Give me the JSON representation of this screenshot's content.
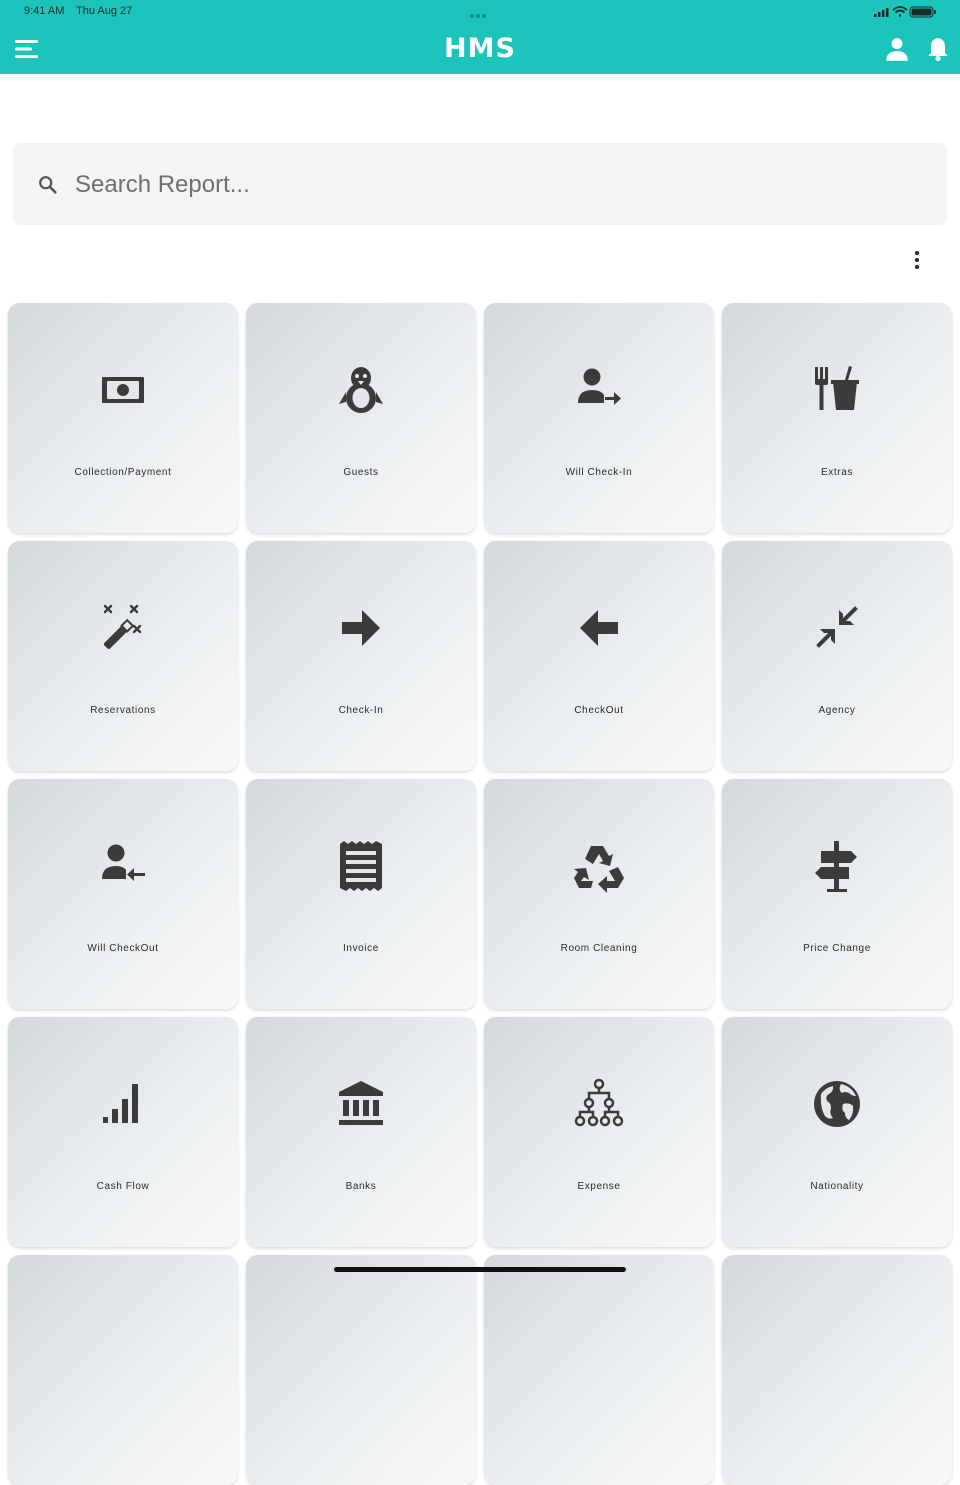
{
  "status_bar": {
    "time": "9:41 AM",
    "date": "Thu Aug 27"
  },
  "header": {
    "title": "HMS",
    "menu_icon": "hamburger-menu-icon",
    "user_icon": "user-icon",
    "notification_icon": "bell-icon",
    "color": "#1cc4bb"
  },
  "search": {
    "placeholder": "Search Report...",
    "value": ""
  },
  "reports": [
    {
      "label": "Collection/Payment",
      "icon": "money-icon"
    },
    {
      "label": "Guests",
      "icon": "penguin-icon"
    },
    {
      "label": "Will Check-In",
      "icon": "person-arrow-right-icon"
    },
    {
      "label": "Extras",
      "icon": "fastfood-icon"
    },
    {
      "label": "Reservations",
      "icon": "magic-wand-icon"
    },
    {
      "label": "Check-In",
      "icon": "arrow-right-icon"
    },
    {
      "label": "CheckOut",
      "icon": "arrow-left-icon"
    },
    {
      "label": "Agency",
      "icon": "collapse-arrows-icon"
    },
    {
      "label": "Will CheckOut",
      "icon": "person-arrow-left-icon"
    },
    {
      "label": "Invoice",
      "icon": "receipt-icon"
    },
    {
      "label": "Room Cleaning",
      "icon": "recycle-icon"
    },
    {
      "label": "Price Change",
      "icon": "signpost-icon"
    },
    {
      "label": "Cash Flow",
      "icon": "signal-bars-icon"
    },
    {
      "label": "Banks",
      "icon": "bank-icon"
    },
    {
      "label": "Expense",
      "icon": "hierarchy-icon"
    },
    {
      "label": "Nationality",
      "icon": "globe-icon"
    }
  ]
}
